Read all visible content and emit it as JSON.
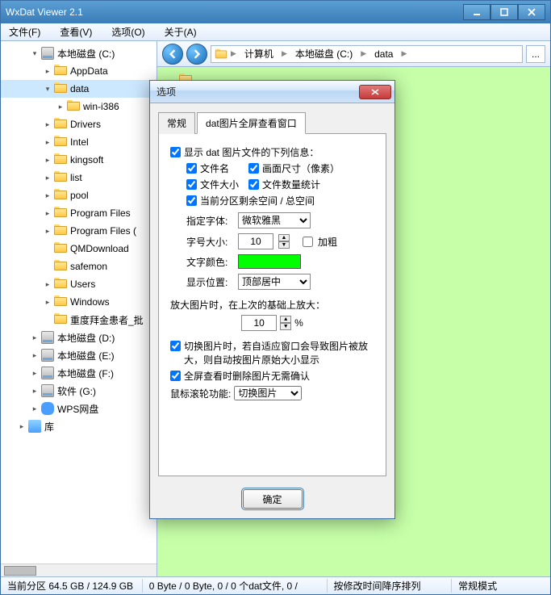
{
  "window": {
    "title": "WxDat Viewer 2.1"
  },
  "menu": {
    "file": "文件(F)",
    "view": "查看(V)",
    "options": "选项(O)",
    "about": "关于(A)"
  },
  "tree": {
    "items": [
      {
        "indent": 1,
        "exp": "▾",
        "icon": "disk",
        "label": "本地磁盘 (C:)"
      },
      {
        "indent": 2,
        "exp": "▸",
        "icon": "folder",
        "label": "AppData"
      },
      {
        "indent": 2,
        "exp": "▾",
        "icon": "folder",
        "label": "data",
        "selected": true
      },
      {
        "indent": 3,
        "exp": "▸",
        "icon": "folder",
        "label": "win-i386"
      },
      {
        "indent": 2,
        "exp": "▸",
        "icon": "folder",
        "label": "Drivers"
      },
      {
        "indent": 2,
        "exp": "▸",
        "icon": "folder",
        "label": "Intel"
      },
      {
        "indent": 2,
        "exp": "▸",
        "icon": "folder",
        "label": "kingsoft"
      },
      {
        "indent": 2,
        "exp": "▸",
        "icon": "folder",
        "label": "list"
      },
      {
        "indent": 2,
        "exp": "▸",
        "icon": "folder",
        "label": "pool"
      },
      {
        "indent": 2,
        "exp": "▸",
        "icon": "folder",
        "label": "Program Files"
      },
      {
        "indent": 2,
        "exp": "▸",
        "icon": "folder",
        "label": "Program Files ("
      },
      {
        "indent": 2,
        "exp": "",
        "icon": "folder",
        "label": "QMDownload"
      },
      {
        "indent": 2,
        "exp": "",
        "icon": "folder",
        "label": "safemon"
      },
      {
        "indent": 2,
        "exp": "▸",
        "icon": "folder",
        "label": "Users"
      },
      {
        "indent": 2,
        "exp": "▸",
        "icon": "folder",
        "label": "Windows"
      },
      {
        "indent": 2,
        "exp": "",
        "icon": "folder",
        "label": "重度拜金患者_批"
      },
      {
        "indent": 1,
        "exp": "▸",
        "icon": "disk",
        "label": "本地磁盘 (D:)"
      },
      {
        "indent": 1,
        "exp": "▸",
        "icon": "disk",
        "label": "本地磁盘 (E:)"
      },
      {
        "indent": 1,
        "exp": "▸",
        "icon": "disk",
        "label": "本地磁盘 (F:)"
      },
      {
        "indent": 1,
        "exp": "▸",
        "icon": "disk",
        "label": "软件 (G:)"
      },
      {
        "indent": 1,
        "exp": "▸",
        "icon": "cloud",
        "label": "WPS网盘"
      },
      {
        "indent": 0,
        "exp": "▸",
        "icon": "lib",
        "label": "库"
      }
    ]
  },
  "breadcrumb": {
    "items": [
      "计算机",
      "本地磁盘 (C:)",
      "data"
    ],
    "more": "..."
  },
  "status": {
    "seg1": "当前分区 64.5 GB / 124.9 GB",
    "seg2": "0 Byte / 0 Byte,  0 / 0 个dat文件,  0 /",
    "seg3": "按修改时间降序排列",
    "seg4": "常规模式"
  },
  "dialog": {
    "title": "选项",
    "tabs": {
      "general": "常规",
      "fullscreen": "dat图片全屏查看窗口"
    },
    "group_show_info": "显示 dat 图片文件的下列信息：",
    "chk_filename": "文件名",
    "chk_dimensions": "画面尺寸（像素）",
    "chk_filesize": "文件大小",
    "chk_count": "文件数量统计",
    "chk_diskspace": "当前分区剩余空间 / 总空间",
    "font_label": "指定字体:",
    "font_value": "微软雅黑",
    "size_label": "字号大小:",
    "size_value": "10",
    "bold_label": "加粗",
    "color_label": "文字颜色:",
    "color_value": "#00ff00",
    "pos_label": "显示位置:",
    "pos_value": "顶部居中",
    "zoom_section": "放大图片时，在上次的基础上放大：",
    "zoom_value": "10",
    "zoom_unit": "%",
    "chk_switch_resize": "切换图片时，若自适应窗口会导致图片被放大，则自动按图片原始大小显示",
    "chk_delete_noconfirm": "全屏查看时删除图片无需确认",
    "wheel_label": "鼠标滚轮功能:",
    "wheel_value": "切换图片",
    "ok": "确定"
  }
}
